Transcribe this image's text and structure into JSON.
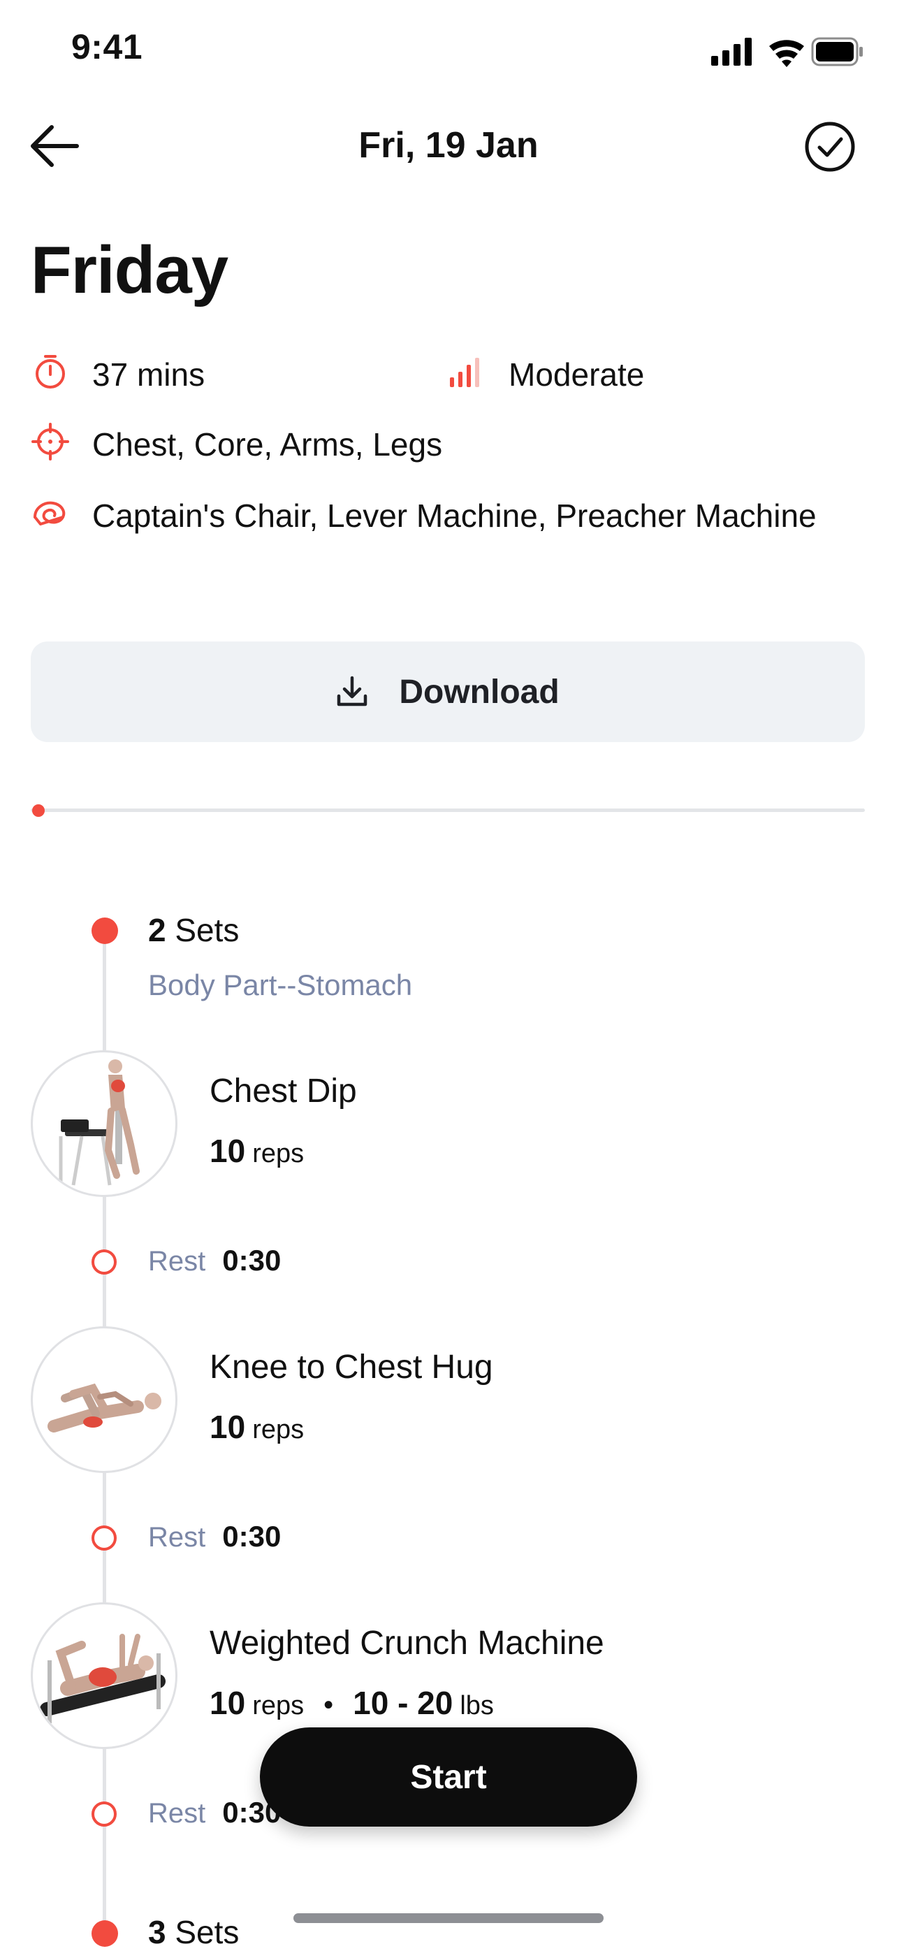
{
  "status_bar": {
    "time": "9:41"
  },
  "nav": {
    "title": "Fri, 19 Jan"
  },
  "workout": {
    "title": "Friday",
    "duration": "37 mins",
    "intensity": "Moderate",
    "target_muscles": "Chest, Core, Arms, Legs",
    "equipment": "Captain's Chair, Lever Machine, Preacher Machine"
  },
  "download": {
    "label": "Download"
  },
  "groups": [
    {
      "sets_count": "2",
      "sets_word": "Sets",
      "body_part": "Body Part--Stomach",
      "exercises": [
        {
          "name": "Chest Dip",
          "reps": "10",
          "reps_unit": "reps"
        },
        {
          "name": "Knee to Chest Hug",
          "reps": "10",
          "reps_unit": "reps"
        },
        {
          "name": "Weighted Crunch Machine",
          "reps": "10",
          "reps_unit": "reps",
          "separator": "•",
          "weight": "10 - 20",
          "weight_unit": "lbs"
        }
      ],
      "rests": [
        {
          "label": "Rest",
          "time": "0:30"
        },
        {
          "label": "Rest",
          "time": "0:30"
        },
        {
          "label": "Rest",
          "time": "0:30"
        }
      ]
    },
    {
      "sets_count": "3",
      "sets_word": "Sets"
    }
  ],
  "start": {
    "label": "Start"
  },
  "colors": {
    "accent": "#f24b3f",
    "secondary_text": "#7a86a6",
    "button_bg": "#eff2f5"
  },
  "icons": {
    "duration": "stopwatch-icon",
    "intensity": "signal-bars-icon",
    "target": "crosshair-icon",
    "equipment": "equipment-icon",
    "download": "download-icon",
    "back": "arrow-left-icon",
    "complete": "check-circle-icon"
  }
}
